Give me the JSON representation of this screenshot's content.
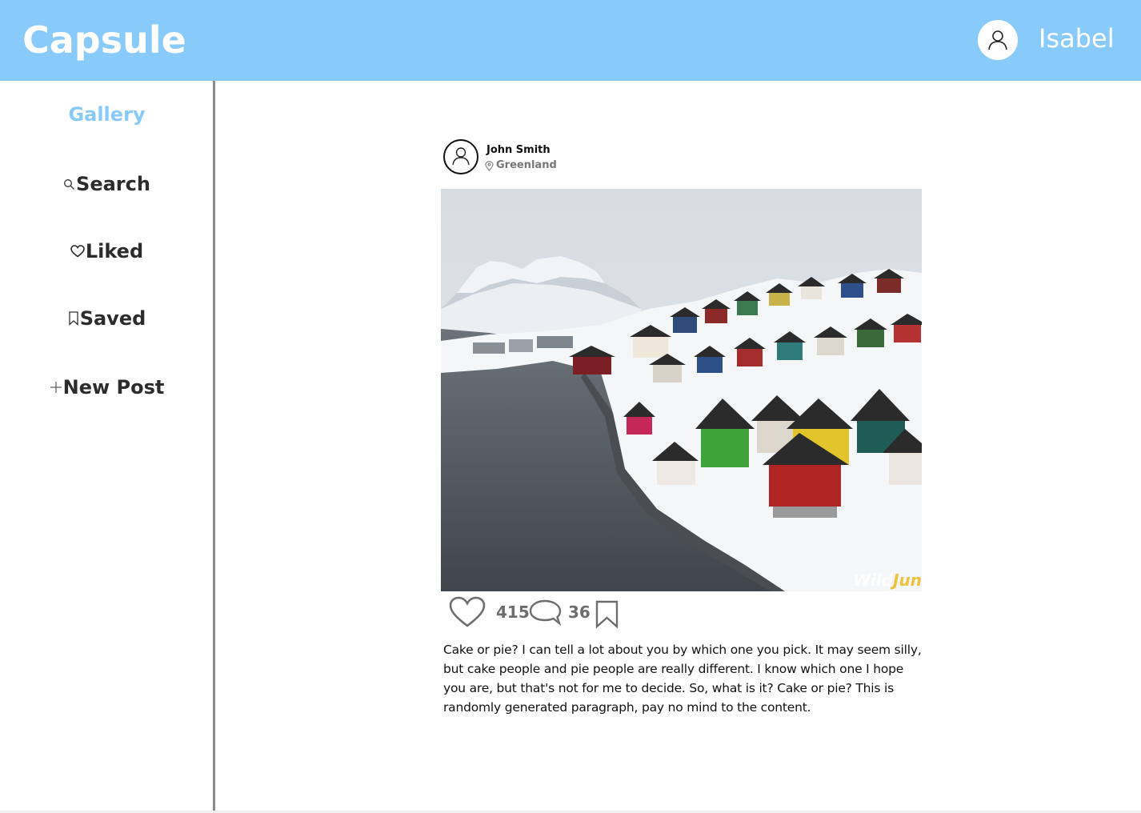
{
  "header": {
    "app_name": "Capsule",
    "user_name": "Isabel",
    "background_color": "#88cafa"
  },
  "sidebar": {
    "items": [
      {
        "label": "Gallery",
        "icon": "",
        "active": true
      },
      {
        "label": "Search",
        "icon": "search-icon",
        "active": false
      },
      {
        "label": "Liked",
        "icon": "heart-icon",
        "active": false
      },
      {
        "label": "Saved",
        "icon": "bookmark-icon",
        "active": false
      },
      {
        "label": "New Post",
        "icon": "plus-icon",
        "active": false
      }
    ],
    "active_color": "#88cafa"
  },
  "post": {
    "author": "John Smith",
    "location": "Greenland",
    "photo_watermark_a": "Wild",
    "photo_watermark_b": "Jun",
    "likes": "415",
    "comments": "36",
    "caption": "Cake or pie? I can tell a lot about you by which one you pick. It may seem silly, but cake people and pie people are really different. I know which one I hope you are, but that's not for me to decide. So, what is it? Cake or pie? This is randomly generated paragraph, pay no mind to the content."
  }
}
